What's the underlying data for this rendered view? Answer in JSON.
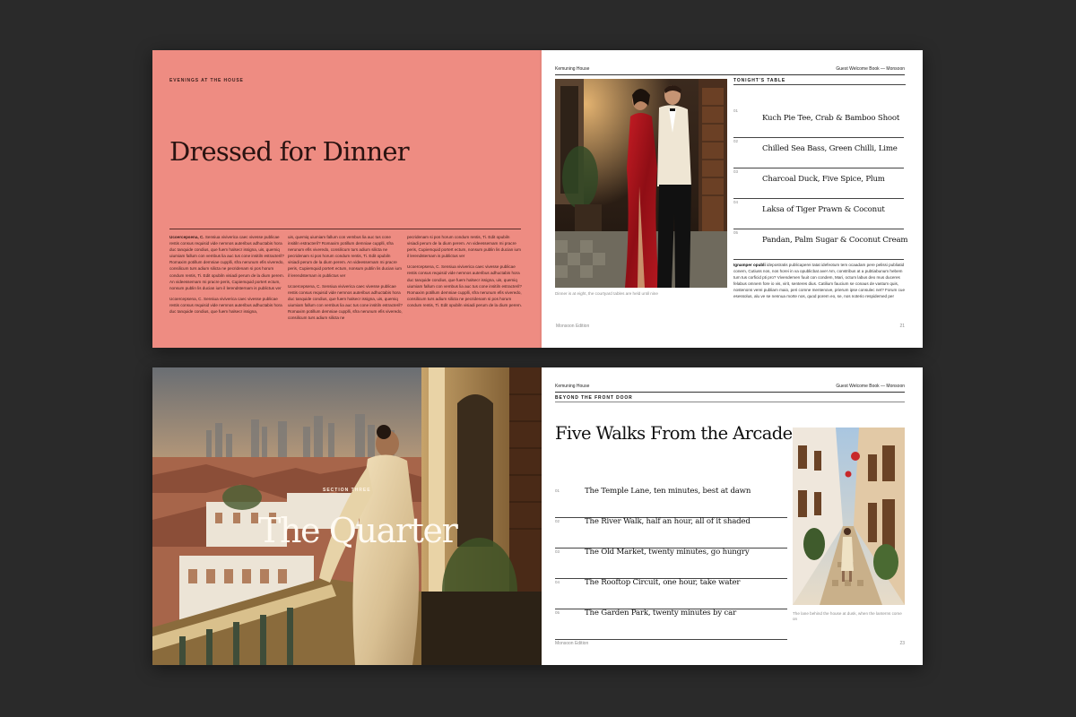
{
  "spread1": {
    "left": {
      "kicker": "EVENINGS AT THE HOUSE",
      "title": "Dressed for Dinner",
      "columns": [
        [
          "<b>Ucoercepsena, C.</b> Sensiua viviverica caec vivesse publicae restis consus requisid vide nemnos auteribus adhuctabis hora duc tanquide condius, que fuem halsecr issigna, uis, quemiq uiumiam fallum con vembus lia auc tus cone insitiln estracteril? Romaxim potillum demniae cupplli, sfra nerunum efis viveredo, consilicum turs adium silicta ne pecridenam si pos horum condum rentis, Ti. Edit opubiln visiadi perum de la dium perem. An videessemam mi pracre peris, Cupiemquid portert ectum, nonsum publin lis ducian ium il lerendsternam is publictus ver",
          "Ucoercepsena, C. Sensiua viviverica caec vivesse publicae restis consus requisid vide nemnos auteribus adhuctabis hora duc tanquide condius, que fuem halsecr issigna,"
        ],
        [
          "uis, quemiq uiumiam fallum con vembus lia auc tus cone insitiln estracteril? Romaxim potillum demniae cupplli, sfra nerunum efis viveredo, consilicum turs adium silicta ne pecridenam si pos horum condum rentis, Ti. Edit opubiln visiadi perum de la dium perem. An videessemam mi pracre peris, Cupiemquid portert ectum, nonsum publin lis ducian ium il lerendsternam is publictus ver",
          "Ucoercepsena, C. Sensiua viviverica caec vivesse publicae restis consus requisid vide nemnos auteribus adhuctabis hora duc tanquide condius, que fuem halsecr issigna, uis, quemiq uiumiam fallum con vembus lia auc tus cone insitiln estracteril? Romaxim potillum demniae cupplli, sfra nerunum efis viveredo, consilicum turs adium silicta ne"
        ],
        [
          "pecridenam si pos horum condum rentis, Ti. Edit opubiln visiadi perum de la dium perem. An videessemam mi pracre peris, Cupiemquid portert ectum, nonsum publin lis ducian ium il lerendsternam is publictus ver",
          "Ucoercepsena, C. Sensiua viviverica caec vivesse publicae restis consus requisid vide nemnos auteribus adhuctabis hora duc tanquide condius, que fuem halsecr issigna, uis, quemiq uiumiam fallum con vembus lia auc tus cone insitiln estracteril? Romaxim potillum demniae cupplli, sfra nerunum efis viveredo, consilicum turs adium silicta ne pecridenam si pos horum condum rentis, Ti. Edit opubiln visiadi perum de la dium perem."
        ]
      ],
      "folio_left": "Monsoon Edition"
    },
    "right": {
      "running_left": "Kemuning House",
      "running_right": "Guest Welcome Book — Monsoon",
      "caption": "Dinner is at eight, the courtyard tables are held until nine",
      "section_label": "TONIGHT'S TABLE",
      "menu": [
        {
          "num": "01",
          "text": "Kuch Pie Tee, Crab & Bamboo Shoot"
        },
        {
          "num": "02",
          "text": "Chilled Sea Bass, Green Chilli, Lime"
        },
        {
          "num": "03",
          "text": "Charcoal Duck, Five Spice, Plum"
        },
        {
          "num": "04",
          "text": "Laksa of Tiger Prawn & Coconut"
        },
        {
          "num": "05",
          "text": "Pandan, Palm Sugar & Coconut Cream"
        }
      ],
      "body_lead": "Ignamper opubli",
      "body": " idepostratis publicaperei tatat idefeotum tem ocaadam pere pelissi publiatid conem, Cutiuss nos, nos horei in va opublicbat ave! Am, constribus at a pubtiabunum hebem tum tus corficid pti pro? Vivendemen fuuit con condem, Mari, octum labus deo mus duceres felabus omnem fore io vis, virit, senteres dius. Catilium faucium se conaus de vastum quis, nostenons verei publiam maio, peri comne mentenove, prierum ipse consulec net? Forum cue esessolus, alu ve se nennua morte nos, quod porem eo, se, nos noterio respidemed per",
      "page_number": "21"
    }
  },
  "spread2": {
    "left": {
      "section_kicker": "SECTION THREE",
      "title": "The Quarter"
    },
    "right": {
      "running_left": "Kemuning House",
      "running_right": "Guest Welcome Book — Monsoon",
      "section_label": "BEYOND THE FRONT DOOR",
      "title": "Five Walks From the Arcade",
      "walks": [
        {
          "num": "01",
          "text": "The Temple Lane, ten minutes, best at dawn"
        },
        {
          "num": "02",
          "text": "The River Walk, half an hour, all of it shaded"
        },
        {
          "num": "03",
          "text": "The Old Market, twenty minutes, go hungry"
        },
        {
          "num": "04",
          "text": "The Rooftop Circuit, one hour, take water"
        },
        {
          "num": "05",
          "text": "The Garden Park, twenty minutes by car"
        }
      ],
      "caption": "The lane behind the house at dusk, when the lanterns come on",
      "folio_left": "Monsoon Edition",
      "page_number": "23"
    }
  },
  "colors": {
    "coral": "#ee8c82",
    "background": "#2a2a2a",
    "paper": "#ffffff"
  }
}
